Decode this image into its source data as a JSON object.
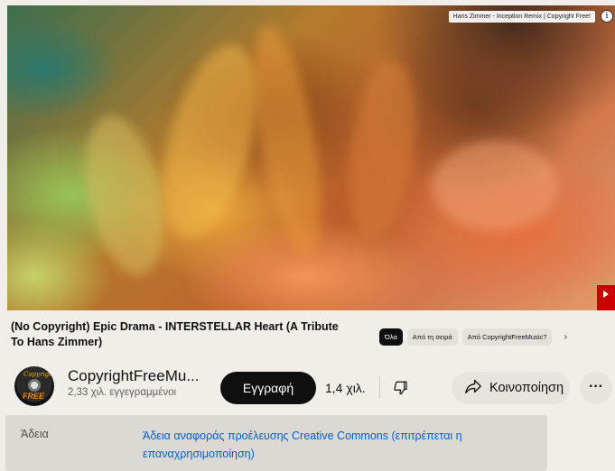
{
  "player": {
    "overlay_title": "Hans Zimmer - Inception Remix | Copyright Free!",
    "info_icon": "info-icon",
    "corner_icon": "youtube-logo-icon"
  },
  "video": {
    "title": "(No Copyright) Epic Drama - INTERSTELLAR Heart (A Tribute To Hans Zimmer)"
  },
  "chips": [
    {
      "label": "Όλα",
      "active": true
    },
    {
      "label": "Από τη σειρά",
      "active": false
    },
    {
      "label": "Από CopyrightFreeMusic?",
      "active": false
    }
  ],
  "chips_next_icon": "chevron-right-icon",
  "channel": {
    "name": "CopyrightFreeMu...",
    "subscribers": "2,33 χιλ. εγγεγραμμένοι",
    "avatar_text_top": "Copyright",
    "avatar_text_bottom": "FREE"
  },
  "actions": {
    "subscribe_label": "Εγγραφή",
    "like_count": "1,4 χιλ.",
    "dislike_icon": "thumbs-down-icon",
    "share_label": "Κοινοποίηση",
    "share_icon": "share-arrow-icon",
    "more_label": "···"
  },
  "license": {
    "label": "Άδεια",
    "value": "Άδεια αναφοράς προέλευσης Creative Commons (επιτρέπεται η επαναχρησιμοποίηση)"
  },
  "colors": {
    "link": "#065fd4",
    "subscribe_bg": "#0f0f0f",
    "youtube_red": "#cc0000"
  }
}
